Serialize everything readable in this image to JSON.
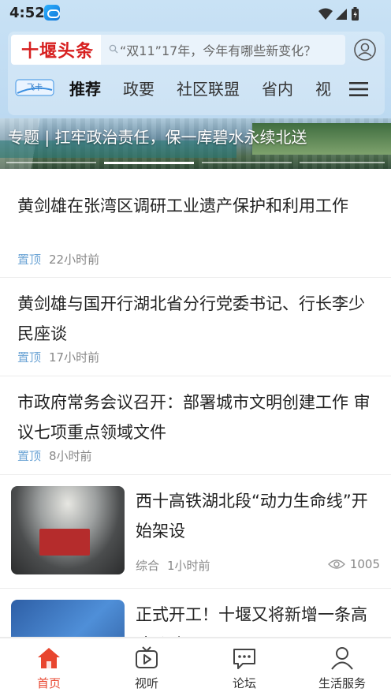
{
  "status": {
    "time": "4:52"
  },
  "header": {
    "logo": "十堰头条",
    "search_placeholder": "“双11”17年，今年有哪些新变化？",
    "channel_logo_text": "飞卡",
    "tabs": [
      "推荐",
      "政要",
      "社区联盟",
      "省内",
      "视"
    ],
    "active_tab": "推荐"
  },
  "banner": {
    "title": "专题 | 扛牢政治责任，保一库碧水永续北送",
    "slide_count": 4,
    "active_slide": 2
  },
  "news": [
    {
      "title": "黄剑雄在张湾区调研工业遗产保护和利用工作",
      "tag": "置顶",
      "time": "22小时前"
    },
    {
      "title": "黄剑雄与国开行湖北省分行党委书记、行长李少民座谈",
      "tag": "置顶",
      "time": "17小时前"
    },
    {
      "title": "市政府常务会议召开：部署城市文明创建工作 审议七项重点领域文件",
      "tag": "置顶",
      "time": "8小时前"
    },
    {
      "title": "西十高铁湖北段“动力生命线”开始架设",
      "tag": "综合",
      "time": "1小时前",
      "views": "1005"
    },
    {
      "title": "正式开工！十堰又将新增一条高速公路"
    }
  ],
  "bottom_nav": [
    {
      "label": "首页",
      "icon": "home-icon",
      "active": true
    },
    {
      "label": "视听",
      "icon": "video-icon",
      "active": false
    },
    {
      "label": "论坛",
      "icon": "forum-icon",
      "active": false
    },
    {
      "label": "生活服务",
      "icon": "user-service-icon",
      "active": false
    }
  ],
  "colors": {
    "accent": "#e8462f",
    "tag": "#6fa6d6",
    "logo": "#d71f1f",
    "header_bg": "#c9e2f5"
  }
}
